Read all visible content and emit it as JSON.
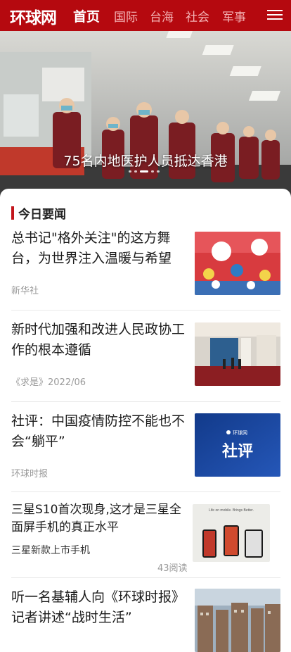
{
  "header": {
    "logo": "环球网",
    "nav": [
      "首页",
      "国际",
      "台海",
      "社会",
      "军事"
    ],
    "menu_icon": "hamburger-menu-icon",
    "brand_color": "#b5090f"
  },
  "hero": {
    "caption": "75名内地医护人员抵达香港",
    "slides": 5,
    "active_slide": 3
  },
  "section": {
    "title": "今日要闻",
    "accent_color": "#c3161c"
  },
  "news": [
    {
      "title": "总书记\"格外关注\"的这方舞台，为世界注入温暖与希望",
      "source": "新华社"
    },
    {
      "title": "新时代加强和改进人民政协工作的根本遵循",
      "source": "《求是》2022/06"
    },
    {
      "title": "社评：中国疫情防控不能也不会“躺平”",
      "source": "环球时报",
      "thumb_text": "社评",
      "thumb_logo": "环球网"
    },
    {
      "title": "三星S10首次现身,这才是三星全面屏手机的真正水平",
      "subtitle": "三星新款上市手机",
      "reads": "43阅读",
      "thumb_text": "Life on mobile. Brings Better."
    },
    {
      "title": "听一名基辅人向《环球时报》记者讲述“战时生活”",
      "source": ""
    }
  ]
}
